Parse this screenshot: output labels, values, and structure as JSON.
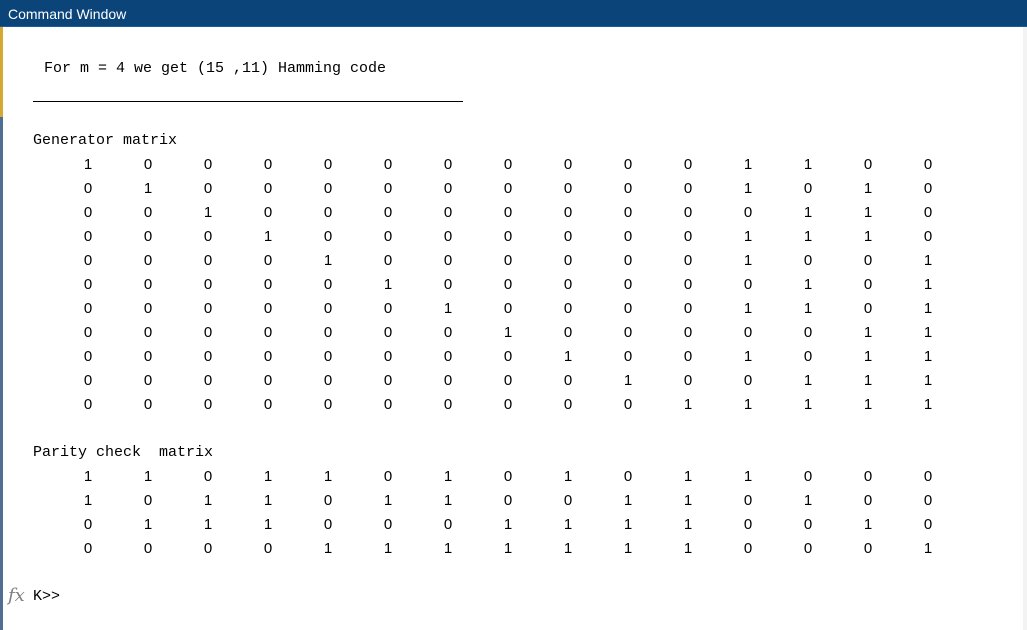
{
  "window": {
    "title": "Command Window"
  },
  "output": {
    "intro": "For m = 4 we get (15 ,11) Hamming code",
    "generator_label": "Generator matrix",
    "generator_matrix": [
      [
        "1",
        "0",
        "0",
        "0",
        "0",
        "0",
        "0",
        "0",
        "0",
        "0",
        "0",
        "1",
        "1",
        "0",
        "0"
      ],
      [
        "0",
        "1",
        "0",
        "0",
        "0",
        "0",
        "0",
        "0",
        "0",
        "0",
        "0",
        "1",
        "0",
        "1",
        "0"
      ],
      [
        "0",
        "0",
        "1",
        "0",
        "0",
        "0",
        "0",
        "0",
        "0",
        "0",
        "0",
        "0",
        "1",
        "1",
        "0"
      ],
      [
        "0",
        "0",
        "0",
        "1",
        "0",
        "0",
        "0",
        "0",
        "0",
        "0",
        "0",
        "1",
        "1",
        "1",
        "0"
      ],
      [
        "0",
        "0",
        "0",
        "0",
        "1",
        "0",
        "0",
        "0",
        "0",
        "0",
        "0",
        "1",
        "0",
        "0",
        "1"
      ],
      [
        "0",
        "0",
        "0",
        "0",
        "0",
        "1",
        "0",
        "0",
        "0",
        "0",
        "0",
        "0",
        "1",
        "0",
        "1"
      ],
      [
        "0",
        "0",
        "0",
        "0",
        "0",
        "0",
        "1",
        "0",
        "0",
        "0",
        "0",
        "1",
        "1",
        "0",
        "1"
      ],
      [
        "0",
        "0",
        "0",
        "0",
        "0",
        "0",
        "0",
        "1",
        "0",
        "0",
        "0",
        "0",
        "0",
        "1",
        "1"
      ],
      [
        "0",
        "0",
        "0",
        "0",
        "0",
        "0",
        "0",
        "0",
        "1",
        "0",
        "0",
        "1",
        "0",
        "1",
        "1"
      ],
      [
        "0",
        "0",
        "0",
        "0",
        "0",
        "0",
        "0",
        "0",
        "0",
        "1",
        "0",
        "0",
        "1",
        "1",
        "1"
      ],
      [
        "0",
        "0",
        "0",
        "0",
        "0",
        "0",
        "0",
        "0",
        "0",
        "0",
        "1",
        "1",
        "1",
        "1",
        "1"
      ]
    ],
    "parity_label": "Parity check  matrix",
    "parity_matrix": [
      [
        "1",
        "1",
        "0",
        "1",
        "1",
        "0",
        "1",
        "0",
        "1",
        "0",
        "1",
        "1",
        "0",
        "0",
        "0"
      ],
      [
        "1",
        "0",
        "1",
        "1",
        "0",
        "1",
        "1",
        "0",
        "0",
        "1",
        "1",
        "0",
        "1",
        "0",
        "0"
      ],
      [
        "0",
        "1",
        "1",
        "1",
        "0",
        "0",
        "0",
        "1",
        "1",
        "1",
        "1",
        "0",
        "0",
        "1",
        "0"
      ],
      [
        "0",
        "0",
        "0",
        "0",
        "1",
        "1",
        "1",
        "1",
        "1",
        "1",
        "1",
        "0",
        "0",
        "0",
        "1"
      ]
    ]
  },
  "prompt": {
    "icon": "fx-icon",
    "icon_glyph": "fx",
    "text": "K>>"
  }
}
